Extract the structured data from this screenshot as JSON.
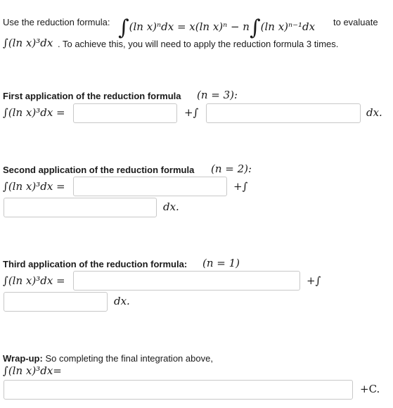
{
  "intro": {
    "prefix": "Use the reduction formula:",
    "formula_lhs": "(ln x)ⁿdx = x(ln x)ⁿ − n",
    "formula_rhs": "(ln x)ⁿ⁻¹dx",
    "suffix": "to evaluate",
    "target": "∫(ln x)³dx",
    "line2": ". To achieve this, you will need to apply the reduction formula 3 times."
  },
  "first": {
    "heading": "First application of the reduction formula",
    "n": "(n = 3):",
    "lhs": "∫(ln x)³dx =",
    "plus_int": "+∫",
    "dx": "dx."
  },
  "second": {
    "heading": "Second application of the reduction formula",
    "n": "(n = 2):",
    "lhs": "∫(ln x)³dx =",
    "plus_int": "+∫",
    "dx": "dx."
  },
  "third": {
    "heading": "Third application of the reduction formula:",
    "n": "(n = 1)",
    "lhs": "∫(ln x)³dx =",
    "plus_int": "+∫",
    "dx": "dx."
  },
  "wrap": {
    "heading": "Wrap-up:",
    "text": "So completing the final integration above,",
    "lhs": "∫(ln x)³dx=",
    "const": "+C."
  },
  "inputs": {
    "first_a": "",
    "first_b": "",
    "second_a": "",
    "second_b": "",
    "third_a": "",
    "third_b": "",
    "wrap": ""
  }
}
